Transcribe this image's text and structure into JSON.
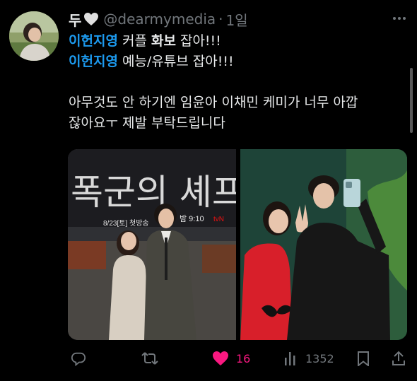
{
  "tweet": {
    "author_name": "두",
    "handle": "@dearmymedia",
    "separator": "·",
    "time": "1일",
    "lines": [
      {
        "bold": "이헌지영",
        "plain": " 커플 ",
        "bold2": "화보",
        "tail": " 잡아!!!"
      },
      {
        "bold": "이헌지영",
        "plain": " 예능/유튜브 잡아!!!"
      }
    ],
    "body_lines": [
      "아무것도 안 하기엔 임윤아 이채민 케미가 너무 아깝",
      "잖아요ㅜ 제발 부탁드립니다"
    ],
    "media": {
      "left_poster_text_1": "폭군의 셰프",
      "left_poster_text_2": "8/23[토] 첫방송",
      "left_poster_text_3": "밤 9:10",
      "left_poster_text_4": "tvN"
    }
  },
  "actions": {
    "likes": "16",
    "views": "1352"
  },
  "colors": {
    "accent_blue": "#1d9bf0",
    "like_pink": "#f91880",
    "muted": "#71767b"
  }
}
